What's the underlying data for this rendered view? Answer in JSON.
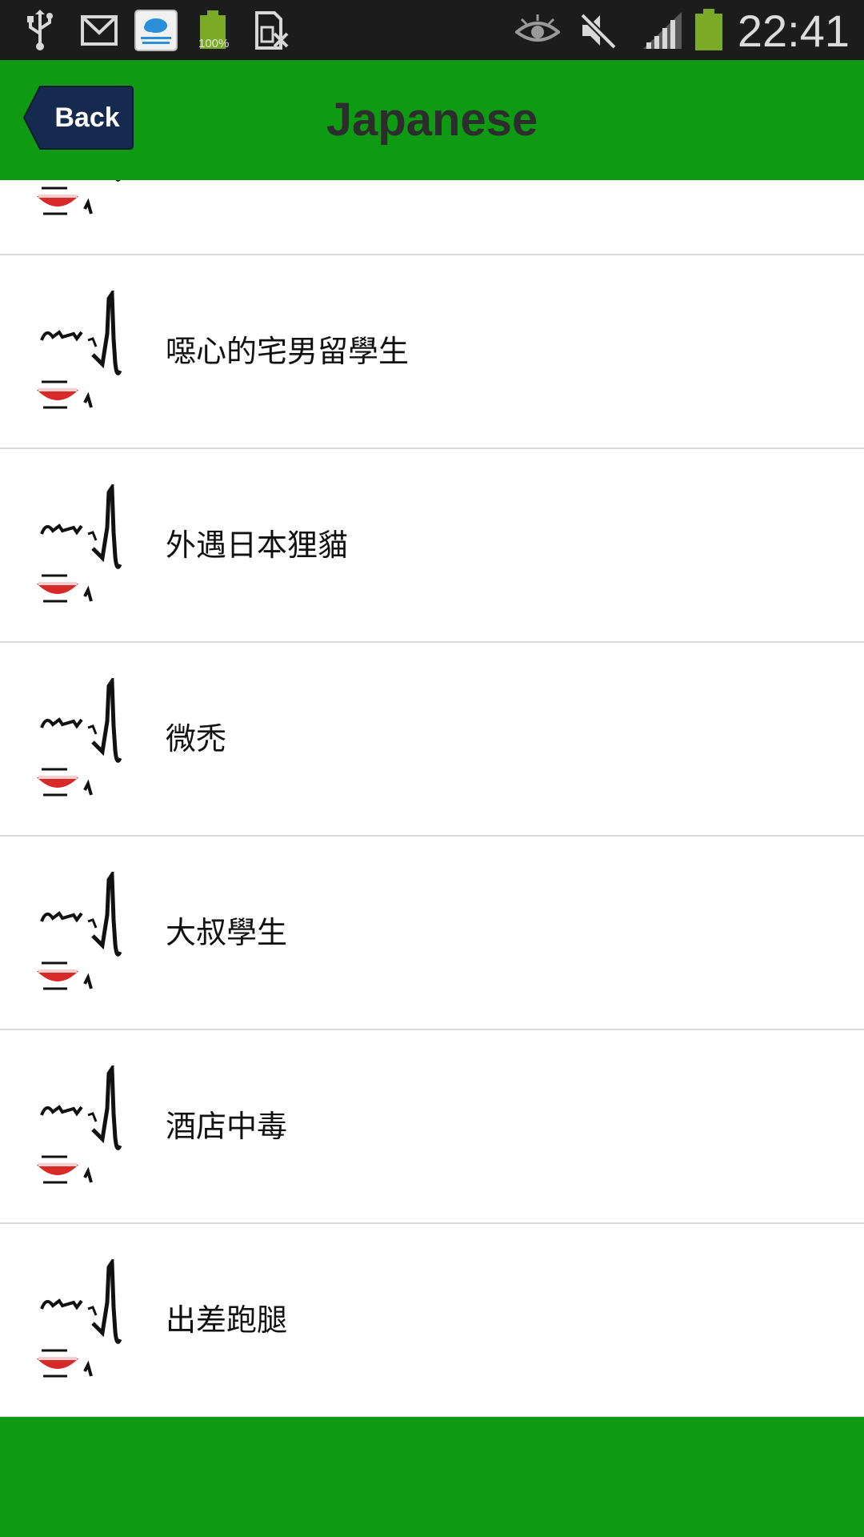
{
  "status_bar": {
    "time": "22:41",
    "battery_percent_label": "100%",
    "icons": [
      "usb-icon",
      "gmail-icon",
      "cloud-testing-icon",
      "battery-app-icon",
      "sim-missing-icon",
      "eye-icon",
      "mute-icon",
      "signal-icon",
      "battery-icon"
    ]
  },
  "header": {
    "back_label": "Back",
    "title": "Japanese"
  },
  "list": {
    "items": [
      {
        "label": ""
      },
      {
        "label": "噁心的宅男留學生"
      },
      {
        "label": "外遇日本狸貓"
      },
      {
        "label": "微禿"
      },
      {
        "label": "大叔學生"
      },
      {
        "label": "酒店中毒"
      },
      {
        "label": "出差跑腿"
      }
    ]
  },
  "colors": {
    "header_green": "#0f9a14",
    "back_button_navy": "#162a4f",
    "status_bar": "#1c1c1c"
  }
}
